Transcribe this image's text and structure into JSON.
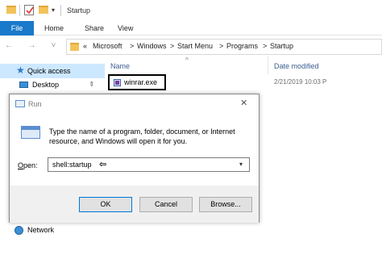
{
  "window": {
    "title": "Startup",
    "quick_access_dropdown": "▾"
  },
  "ribbon": {
    "tabs": [
      {
        "label": "File",
        "active": true
      },
      {
        "label": "Home"
      },
      {
        "label": "Share"
      },
      {
        "label": "View"
      }
    ],
    "file_tab_color": "#1979ca"
  },
  "address_bar": {
    "nav_arrows": "← → ˅ ↑",
    "breadcrumbs": [
      "«",
      "Microsoft",
      ">",
      "Windows",
      ">",
      "Start Menu",
      ">",
      "Programs",
      ">",
      "Startup"
    ]
  },
  "navigation": {
    "quick_access_label": "Quick access",
    "desktop_label": "Desktop",
    "network_label": "Network",
    "selected_color": "#cce8ff"
  },
  "file_list": {
    "columns": [
      "Name",
      "Date modified"
    ],
    "sort_indicator": "^",
    "rows": [
      {
        "name": "winrar.exe",
        "date_modified": "2/21/2019 10:03 P"
      }
    ]
  },
  "run_dialog": {
    "title": "Run",
    "close_glyph": "✕",
    "description_line1": "Type the name of a program, folder, document, or Internet",
    "description_line2": "resource, and Windows will open it for you.",
    "open_label_underlined": "O",
    "open_label_rest": "pen:",
    "open_value": "shell:startup",
    "buttons": {
      "ok": "OK",
      "cancel": "Cancel",
      "browse": "Browse..."
    },
    "accent_color": "#0078d7"
  }
}
